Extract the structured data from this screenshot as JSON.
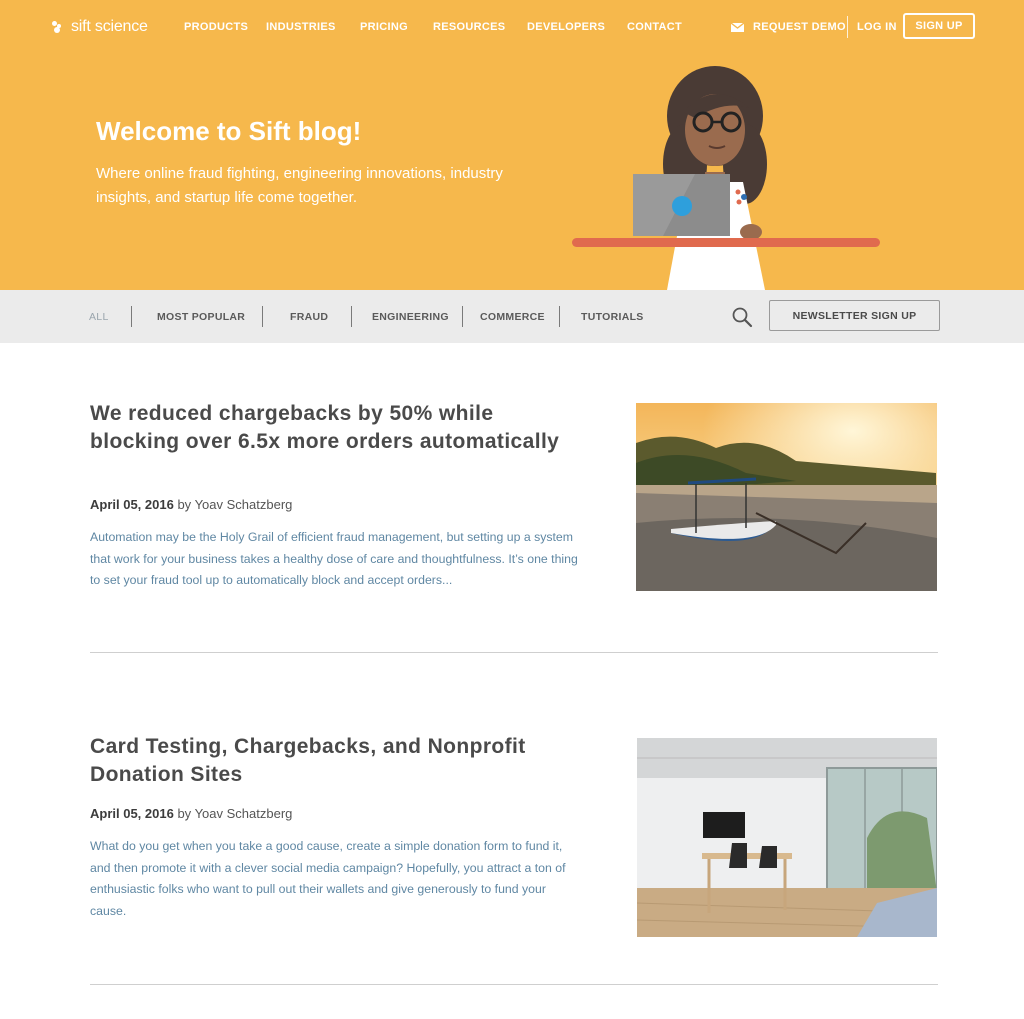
{
  "brand": {
    "logo_text": "sift science",
    "accent": "#f6b84c",
    "link_color": "#5f87a3",
    "desk_color": "#e06a4e"
  },
  "nav": {
    "items": [
      "PRODUCTS",
      "INDUSTRIES",
      "PRICING",
      "RESOURCES",
      "DEVELOPERS",
      "CONTACT"
    ],
    "request_demo": "REQUEST DEMO",
    "request_demo_icon": "mail-icon",
    "login": "LOG IN",
    "signup": "SIGN UP"
  },
  "hero": {
    "title": "Welcome to Sift blog!",
    "subtitle": "Where online fraud fighting, engineering innovations, industry insights, and startup life come together.",
    "illustration": "woman-with-laptop-illustration"
  },
  "categories": {
    "items": [
      "ALL",
      "MOST POPULAR",
      "FRAUD",
      "ENGINEERING",
      "COMMERCE",
      "TUTORIALS"
    ],
    "active": "ALL",
    "search_icon": "search-icon",
    "newsletter": "NEWSLETTER SIGN UP"
  },
  "posts": [
    {
      "title": "We reduced chargebacks by 50% while blocking over 6.5x more orders automatically",
      "date": "April 05, 2016",
      "by": "by",
      "author": "Yoav Schatzberg",
      "excerpt": "Automation may be the Holy Grail of efficient fraud management, but setting up a system that work for your business takes a healthy dose of care and thoughtfulness. It’s one thing to set your fraud tool up to automatically block and accept orders...",
      "image": "boat-at-sunset-photo"
    },
    {
      "title": "Card Testing, Chargebacks, and Nonprofit Donation Sites",
      "date": "April 05, 2016",
      "by": "by",
      "author": "Yoav Schatzberg",
      "excerpt": "What do you get when you take a good cause, create a simple donation form to fund it, and then promote it with a clever social media campaign? Hopefully, you attract a ton of enthusiastic folks who want to pull out their wallets and give generously to fund your cause.",
      "image": "office-room-photo"
    }
  ]
}
